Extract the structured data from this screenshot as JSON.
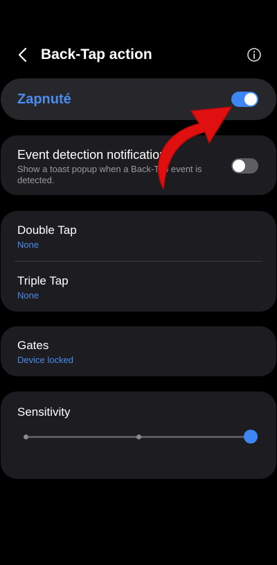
{
  "header": {
    "title": "Back-Tap action",
    "back_icon": "back-arrow-icon",
    "info_icon": "info-icon"
  },
  "master": {
    "label": "Zapnuté",
    "enabled": true
  },
  "notification": {
    "title": "Event detection notification",
    "description": "Show a toast popup when a Back-Tap event is detected.",
    "enabled": false
  },
  "taps": {
    "double": {
      "title": "Double Tap",
      "value": "None"
    },
    "triple": {
      "title": "Triple Tap",
      "value": "None"
    }
  },
  "gates": {
    "title": "Gates",
    "value": "Device locked"
  },
  "sensitivity": {
    "title": "Sensitivity",
    "steps": 3,
    "selected_step": 3
  },
  "colors": {
    "accent": "#3d86f3",
    "link_text": "#4a8cf0",
    "card": "#1d1d21",
    "annotation_arrow": "#e01010"
  }
}
